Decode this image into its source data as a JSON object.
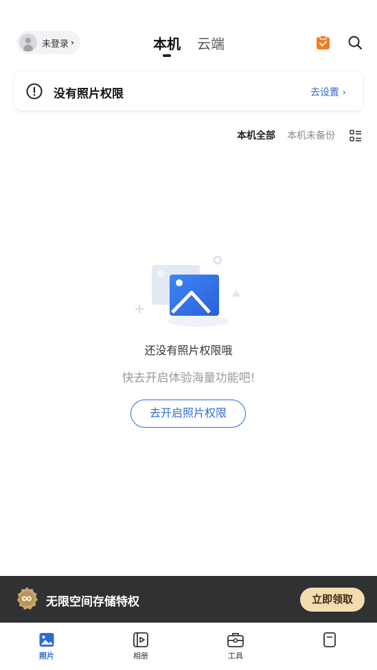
{
  "header": {
    "login_label": "未登录",
    "tabs": [
      {
        "label": "本机",
        "active": true
      },
      {
        "label": "云端",
        "active": false
      }
    ],
    "icons": [
      "user-avatar-icon",
      "clipboard-icon",
      "search-icon"
    ]
  },
  "permission_banner": {
    "message": "没有照片权限",
    "action_label": "去设置 ›"
  },
  "filters": {
    "all_label": "本机全部",
    "unbacked_label": "本机未备份"
  },
  "empty_state": {
    "title": "还没有照片权限哦",
    "subtitle": "快去开启体验海量功能吧!",
    "button_label": "去开启照片权限"
  },
  "promo": {
    "text": "无限空间存储特权",
    "button_label": "立即领取"
  },
  "bottom_nav": {
    "items": [
      {
        "label": "照片",
        "icon": "photo-icon",
        "active": true
      },
      {
        "label": "相册",
        "icon": "album-icon",
        "active": false
      },
      {
        "label": "工具",
        "icon": "toolbox-icon",
        "active": false
      },
      {
        "label": "",
        "icon": "more-icon",
        "active": false
      }
    ]
  },
  "colors": {
    "accent": "#2f6bd8",
    "clipboard": "#f57c1f",
    "promo_bg": "#2f3133",
    "promo_button": "#f3ddb0"
  }
}
